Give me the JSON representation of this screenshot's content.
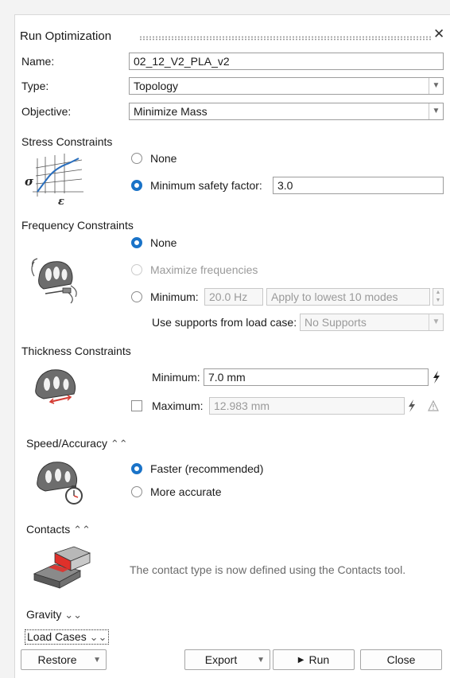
{
  "window": {
    "title": "Run Optimization",
    "close_glyph": "✕"
  },
  "fields": {
    "name_label": "Name:",
    "name_value": "02_12_V2_PLA_v2",
    "type_label": "Type:",
    "type_value": "Topology",
    "objective_label": "Objective:",
    "objective_value": "Minimize Mass"
  },
  "stress": {
    "heading": "Stress Constraints",
    "opt_none": "None",
    "opt_min_sf": "Minimum safety factor:",
    "min_sf_value": "3.0",
    "selected": "min_sf"
  },
  "frequency": {
    "heading": "Frequency Constraints",
    "opt_none": "None",
    "opt_max": "Maximize frequencies",
    "opt_min": "Minimum:",
    "min_value": "20.0 Hz",
    "modes_value": "Apply to lowest 10 modes",
    "supports_label": "Use supports from load case:",
    "supports_value": "No Supports",
    "selected": "none"
  },
  "thickness": {
    "heading": "Thickness Constraints",
    "min_label": "Minimum:",
    "min_value": "7.0 mm",
    "max_label": "Maximum:",
    "max_value": "12.983 mm",
    "max_checked": false
  },
  "speed": {
    "heading": "Speed/Accuracy",
    "opt_faster": "Faster (recommended)",
    "opt_accurate": "More accurate",
    "selected": "faster"
  },
  "contacts": {
    "heading": "Contacts",
    "note": "The contact type is now defined using the Contacts tool."
  },
  "gravity": {
    "heading": "Gravity"
  },
  "loadcases": {
    "heading": "Load Cases"
  },
  "buttons": {
    "restore": "Restore",
    "export": "Export",
    "run": "Run",
    "close": "Close"
  },
  "icons": {
    "close": "close-icon",
    "dropdown": "chevron-down-icon",
    "collapse": "double-chevron-up-icon",
    "expand": "double-chevron-down-icon",
    "lightning": "lightning-icon",
    "warning": "warning-icon",
    "play": "play-icon"
  },
  "colors": {
    "accent": "#1a73c8",
    "contact_red": "#e0302a"
  }
}
